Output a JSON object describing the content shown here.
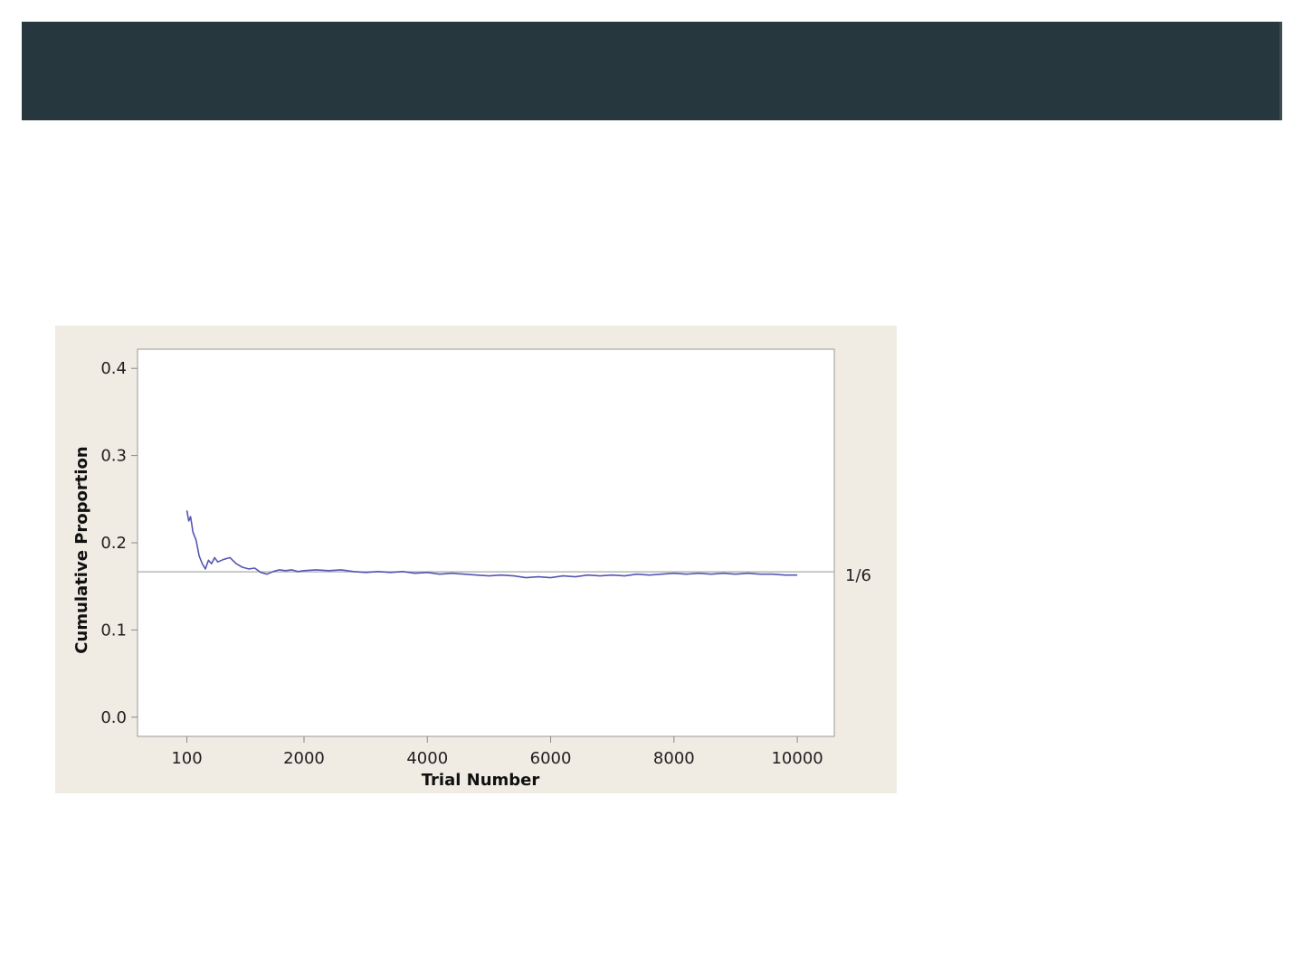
{
  "colors": {
    "header": "#26373d",
    "chart_background": "#f0ebe3",
    "plot_background": "#ffffff",
    "series": "#5656b4",
    "reference_line": "#b8b8b8",
    "axis": "#8a8a8a"
  },
  "chart_data": {
    "type": "line",
    "title": "",
    "xlabel": "Trial Number",
    "ylabel": "Cumulative Proportion",
    "xlim": [
      -700,
      10600
    ],
    "ylim": [
      -0.022,
      0.422
    ],
    "x_ticks": [
      100,
      2000,
      4000,
      6000,
      8000,
      10000
    ],
    "x_tick_labels": [
      "100",
      "2000",
      "4000",
      "6000",
      "8000",
      "10000"
    ],
    "y_ticks": [
      0.0,
      0.1,
      0.2,
      0.3,
      0.4
    ],
    "y_tick_labels": [
      "0.0",
      "0.1",
      "0.2",
      "0.3",
      "0.4"
    ],
    "grid": false,
    "reference_line": {
      "y": 0.1667,
      "label": "1/6"
    },
    "series": [
      {
        "x": [
          100,
          130,
          160,
          200,
          250,
          300,
          350,
          400,
          450,
          500,
          550,
          600,
          700,
          800,
          900,
          1000,
          1100,
          1200,
          1300,
          1400,
          1500,
          1600,
          1700,
          1800,
          1900,
          2000,
          2200,
          2400,
          2600,
          2800,
          3000,
          3200,
          3400,
          3600,
          3800,
          4000,
          4200,
          4400,
          4600,
          4800,
          5000,
          5200,
          5400,
          5600,
          5800,
          6000,
          6200,
          6400,
          6600,
          6800,
          7000,
          7200,
          7400,
          7600,
          7800,
          8000,
          8200,
          8400,
          8600,
          8800,
          9000,
          9200,
          9400,
          9600,
          9800,
          10000
        ],
        "y": [
          0.237,
          0.225,
          0.23,
          0.212,
          0.203,
          0.185,
          0.176,
          0.17,
          0.18,
          0.176,
          0.183,
          0.178,
          0.181,
          0.183,
          0.176,
          0.172,
          0.17,
          0.171,
          0.166,
          0.164,
          0.167,
          0.169,
          0.168,
          0.169,
          0.167,
          0.168,
          0.169,
          0.168,
          0.169,
          0.167,
          0.166,
          0.167,
          0.166,
          0.167,
          0.165,
          0.166,
          0.164,
          0.165,
          0.164,
          0.163,
          0.162,
          0.163,
          0.162,
          0.16,
          0.161,
          0.16,
          0.162,
          0.161,
          0.163,
          0.162,
          0.163,
          0.162,
          0.164,
          0.163,
          0.164,
          0.165,
          0.164,
          0.165,
          0.164,
          0.165,
          0.164,
          0.165,
          0.164,
          0.164,
          0.163,
          0.163
        ]
      }
    ]
  }
}
